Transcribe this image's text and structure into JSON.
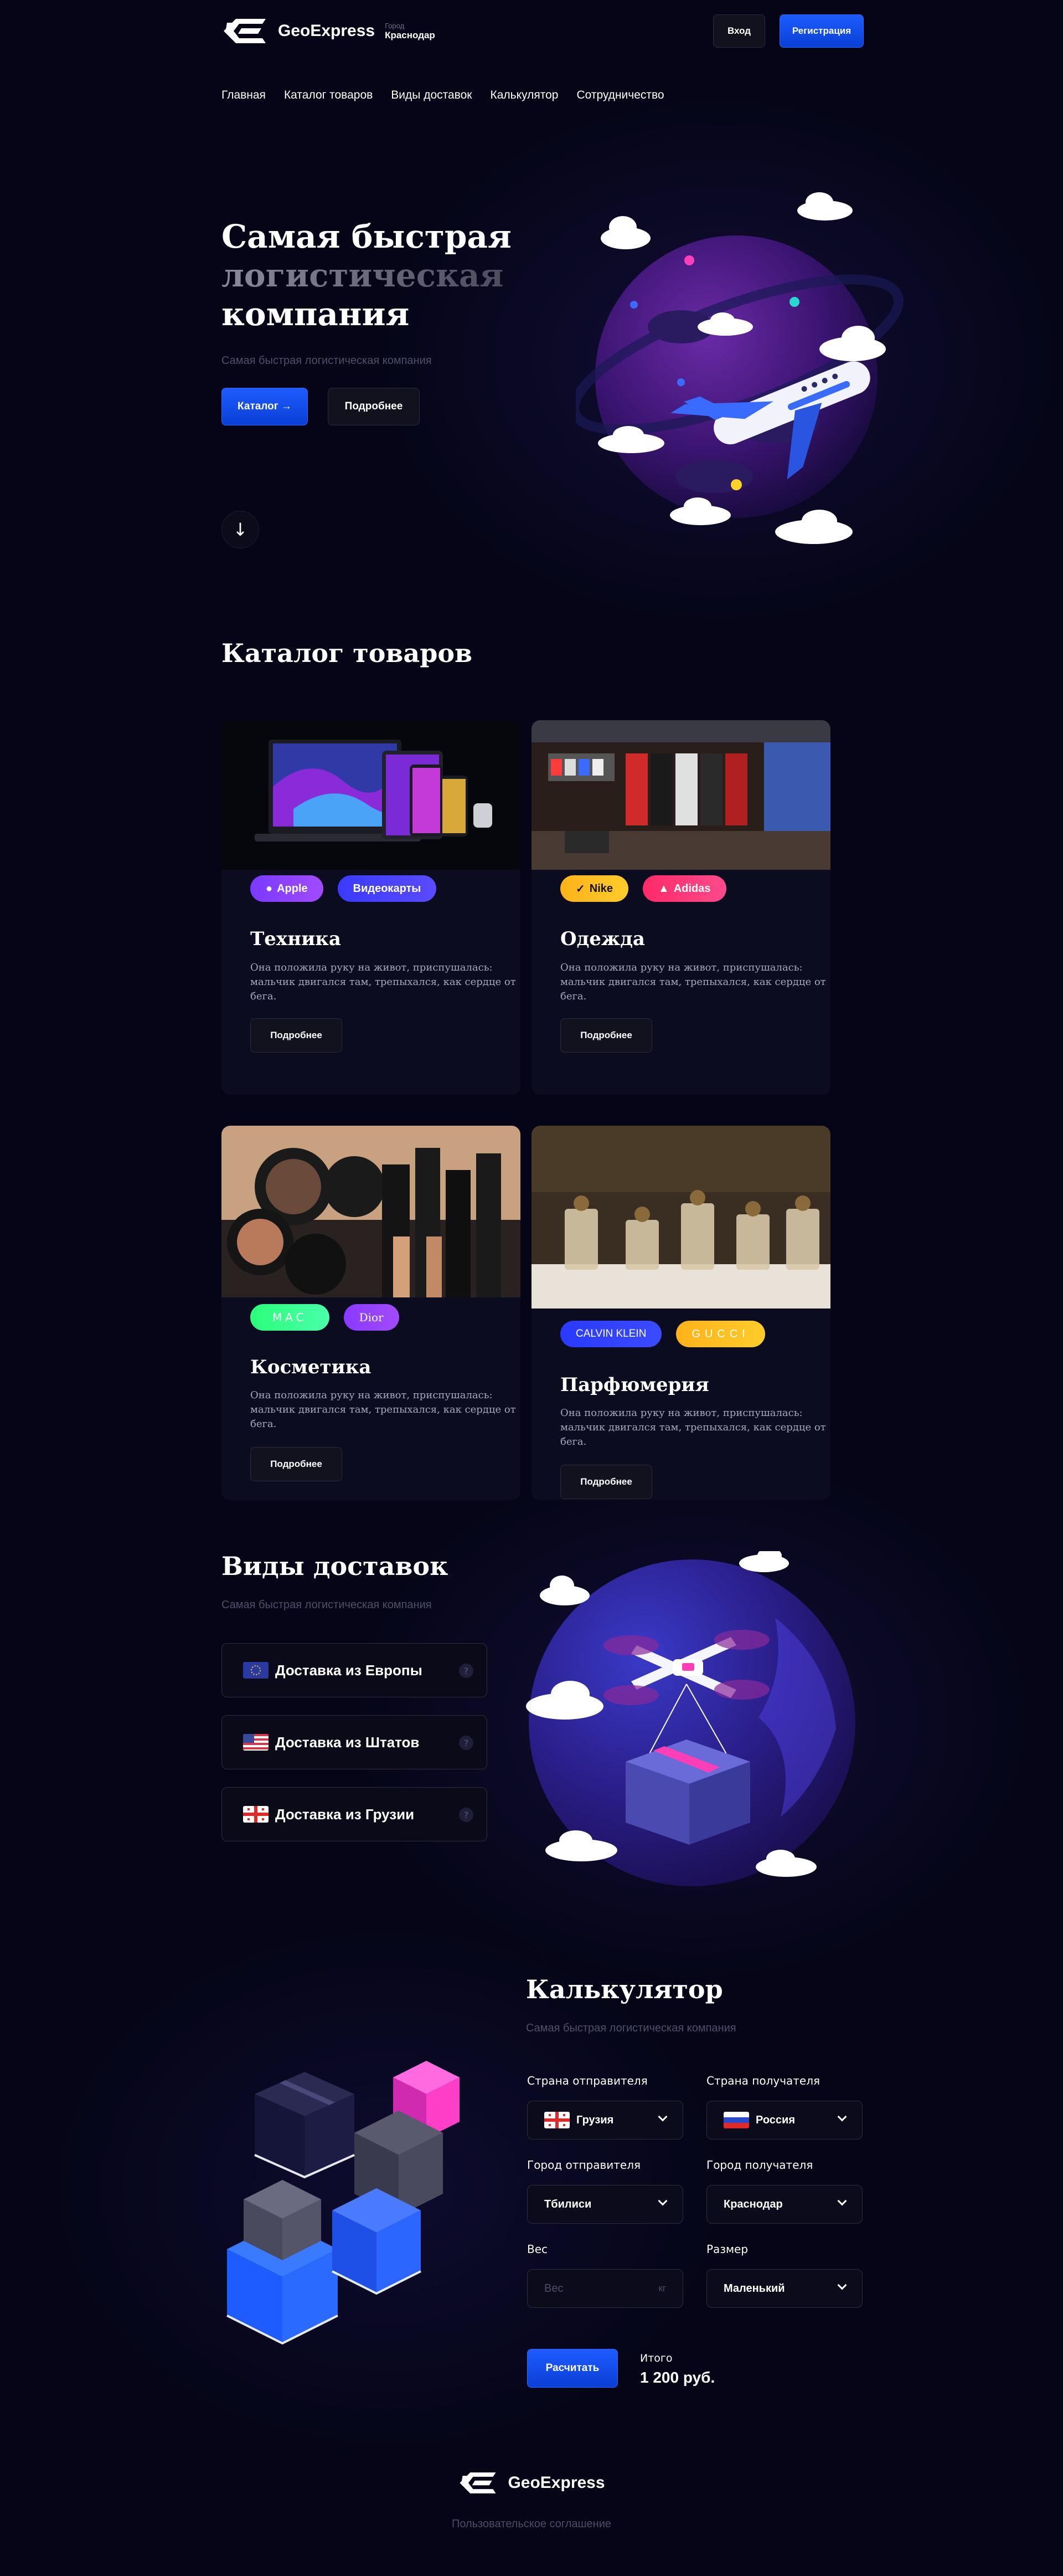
{
  "header": {
    "brand": "GeoExpress",
    "city_label": "Город",
    "city_name": "Краснодар",
    "login": "Вход",
    "register": "Регистрация"
  },
  "nav": [
    "Главная",
    "Каталог товаров",
    "Виды доставок",
    "Калькулятор",
    "Сотрудничество"
  ],
  "hero": {
    "title_line1": "Самая быстрая",
    "title_line2": "логистическая",
    "title_line3": "компания",
    "subtitle": "Самая быстрая логистическая компания",
    "catalog_button": "Каталог →",
    "more_button": "Подробнее",
    "scroll_icon": "arrow-down-icon",
    "scroll_glyph": "↓"
  },
  "catalog": {
    "title": "Каталог товаров",
    "cards": [
      {
        "title": "Техника",
        "desc": "Она положила руку на живот, приспушалась: мальчик двигался там, трепыхался, как сердце от бега.",
        "button": "Подробнее",
        "tags": [
          "Apple",
          "Видеокарты"
        ]
      },
      {
        "title": "Одежда",
        "desc": "Она положила руку на живот, приспушалась: мальчик двигался там, трепыхался, как сердце от бега.",
        "button": "Подробнее",
        "tags": [
          "Nike",
          "Adidas"
        ]
      },
      {
        "title": "Косметика",
        "desc": "Она положила руку на живот, приспушалась: мальчик двигался там, трепыхался, как сердце от бега.",
        "button": "Подробнее",
        "tags": [
          "MAC",
          "Dior"
        ]
      },
      {
        "title": "Парфюмерия",
        "desc": "Она положила руку на живот, приспушалась: мальчик двигался там, трепыхался, как сердце от бега.",
        "button": "Подробнее",
        "tags": [
          "CALVIN KLEIN",
          "GUCCI"
        ]
      }
    ]
  },
  "delivery": {
    "title": "Виды доставок",
    "subtitle": "Самая быстрая логистическая компания",
    "items": [
      "Доставка из Европы",
      "Доставка из Штатов",
      "Доставка из Грузии"
    ]
  },
  "calculator": {
    "title": "Калькулятор",
    "subtitle": "Самая быстрая логистическая компания",
    "sender_country_label": "Страна отправителя",
    "sender_country": "Грузия",
    "receiver_country_label": "Страна получателя",
    "receiver_country": "Россия",
    "sender_city_label": "Город отправителя",
    "sender_city": "Тбилиси",
    "receiver_city_label": "Город получателя",
    "receiver_city": "Краснодар",
    "weight_label": "Вес",
    "weight_placeholder": "Вес",
    "weight_unit": "кг",
    "size_label": "Размер",
    "size_value": "Маленький",
    "calc_button": "Расчитать",
    "total_label": "Итого",
    "total_value": "1 200 руб."
  },
  "footer": {
    "brand": "GeoExpress",
    "agreement": "Пользовательское соглашение"
  },
  "colors": {
    "accent": "#1e5cff",
    "background": "#050517",
    "card": "#0c0c20"
  }
}
